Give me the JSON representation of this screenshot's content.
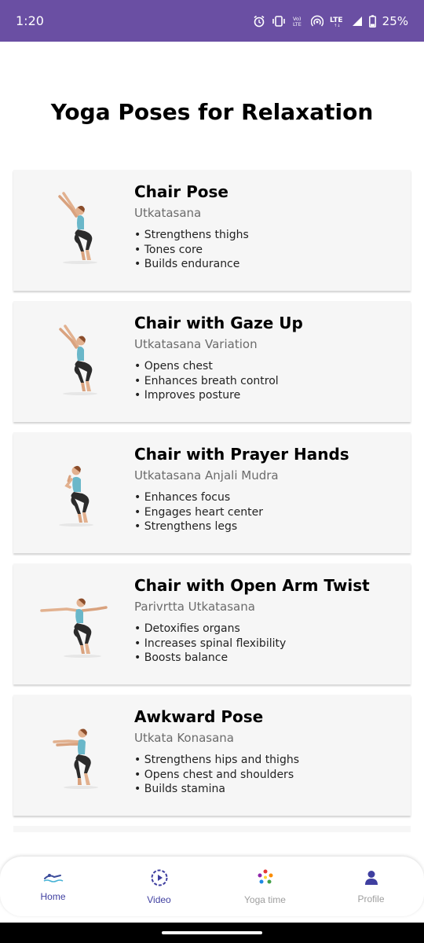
{
  "status_bar": {
    "time": "1:20",
    "battery": "25%",
    "icons": [
      "alarm-icon",
      "vibrate-icon",
      "volte-icon",
      "hotspot-icon",
      "lte-icon",
      "signal-icon",
      "battery-icon"
    ]
  },
  "page": {
    "title": "Yoga Poses for Relaxation"
  },
  "poses": [
    {
      "name": "Chair Pose",
      "sanskrit": "Utkatasana",
      "benefits": [
        "Strengthens thighs",
        "Tones core",
        "Builds endurance"
      ],
      "figure": "arms-up-icon"
    },
    {
      "name": "Chair with Gaze Up",
      "sanskrit": "Utkatasana Variation",
      "benefits": [
        "Opens chest",
        "Enhances breath control",
        "Improves posture"
      ],
      "figure": "arms-up-icon"
    },
    {
      "name": "Chair with Prayer Hands",
      "sanskrit": "Utkatasana Anjali Mudra",
      "benefits": [
        "Enhances focus",
        "Engages heart center",
        "Strengthens legs"
      ],
      "figure": "prayer-icon"
    },
    {
      "name": "Chair with Open Arm Twist",
      "sanskrit": "Parivrtta Utkatasana",
      "benefits": [
        "Detoxifies organs",
        "Increases spinal flexibility",
        "Boosts balance"
      ],
      "figure": "arms-open-icon"
    },
    {
      "name": "Awkward Pose",
      "sanskrit": "Utkata Konasana",
      "benefits": [
        "Strengthens hips and thighs",
        "Opens chest and shoulders",
        "Builds stamina"
      ],
      "figure": "arms-forward-icon"
    }
  ],
  "bottom_nav": {
    "items": [
      {
        "label": "Home",
        "icon": "home-swimmer-icon",
        "active": true
      },
      {
        "label": "Video",
        "icon": "play-circle-icon",
        "active": true
      },
      {
        "label": "Yoga time",
        "icon": "yoga-time-icon",
        "active": false
      },
      {
        "label": "Profile",
        "icon": "person-icon",
        "active": false
      }
    ]
  },
  "colors": {
    "status_bar": "#6a4fa3",
    "card_bg": "#f6f6f6",
    "nav_active": "#3f3fa0",
    "nav_inactive": "#9e9e9e"
  }
}
